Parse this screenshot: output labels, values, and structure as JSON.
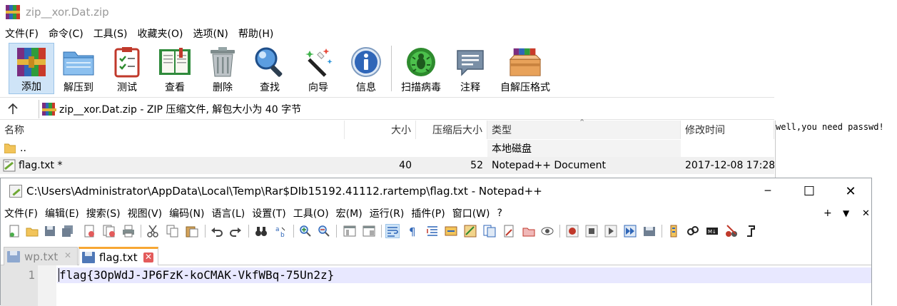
{
  "rar": {
    "title": "zip__xor.Dat.zip",
    "menu": [
      "文件(F)",
      "命令(C)",
      "工具(S)",
      "收藏夹(O)",
      "选项(N)",
      "帮助(H)"
    ],
    "toolbar": [
      {
        "label": "添加",
        "icon": "add-archive-icon"
      },
      {
        "label": "解压到",
        "icon": "extract-to-icon"
      },
      {
        "label": "测试",
        "icon": "test-icon"
      },
      {
        "label": "查看",
        "icon": "view-book-icon"
      },
      {
        "label": "删除",
        "icon": "trash-icon"
      },
      {
        "label": "查找",
        "icon": "magnifier-icon"
      },
      {
        "label": "向导",
        "icon": "wizard-wand-icon"
      },
      {
        "label": "信息",
        "icon": "info-icon"
      },
      {
        "label": "扫描病毒",
        "icon": "virus-scan-icon"
      },
      {
        "label": "注释",
        "icon": "comment-icon"
      },
      {
        "label": "自解压格式",
        "icon": "sfx-box-icon"
      }
    ],
    "address": "zip__xor.Dat.zip - ZIP 压缩文件, 解包大小为 40 字节",
    "columns": {
      "name": "名称",
      "size": "大小",
      "packed": "压缩后大小",
      "type": "类型",
      "modified": "修改时间"
    },
    "rows": [
      {
        "name": "..",
        "size": "",
        "packed": "",
        "type": "本地磁盘",
        "modified": ""
      },
      {
        "name": "flag.txt *",
        "size": "40",
        "packed": "52",
        "type": "Notepad++ Document",
        "modified": "2017-12-08 17:28"
      }
    ],
    "comment": "well,you need passwd!"
  },
  "npp": {
    "title": "C:\\Users\\Administrator\\AppData\\Local\\Temp\\Rar$DIb15192.41112.rartemp\\flag.txt - Notepad++",
    "controls": {
      "minimize": "─",
      "maximize": "☐",
      "close": "✕"
    },
    "menu": [
      "文件(F)",
      "编辑(E)",
      "搜索(S)",
      "视图(V)",
      "编码(N)",
      "语言(L)",
      "设置(T)",
      "工具(O)",
      "宏(M)",
      "运行(R)",
      "插件(P)",
      "窗口(W)",
      "?"
    ],
    "menu_right": {
      "plus": "+",
      "down": "▼",
      "close": "✕"
    },
    "tabs": [
      {
        "label": "wp.txt",
        "close": "✕"
      },
      {
        "label": "flag.txt",
        "close": "✕"
      }
    ],
    "line_number": "1",
    "content": "flag{3OpWdJ-JP6FzK-koCMAK-VkfWBq-75Un2z}"
  },
  "colors": {
    "rar_selection": "#cfe4f7",
    "npp_tab_accent": "#f7a733",
    "npp_current_line": "#e8e8ff"
  }
}
